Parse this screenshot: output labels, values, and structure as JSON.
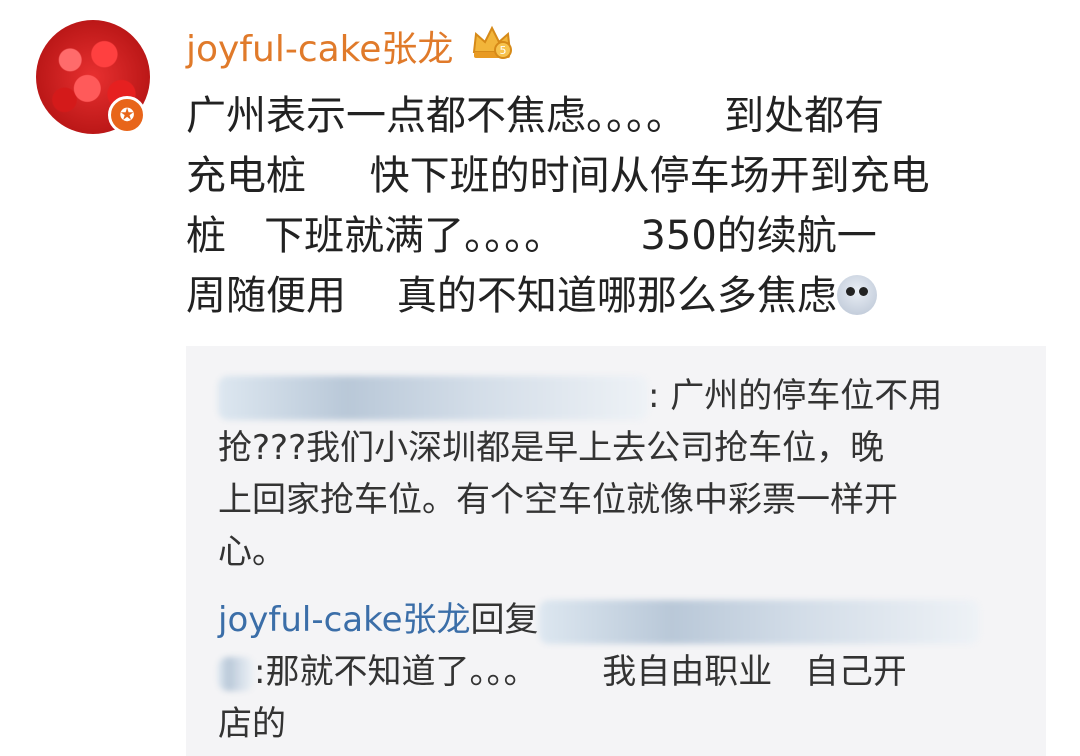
{
  "user": {
    "name": "joyful-cake张龙",
    "avatar_icon": "raspberry-avatar",
    "badge_icon": "star-badge-icon",
    "vip_icon": "crown-icon"
  },
  "comment": {
    "lines": [
      "广州表示一点都不焦虑。。。。   到处都有",
      "充电桩     快下班的时间从停车场开到充电",
      "桩   下班就满了。。。。      350的续航一",
      "周随便用    真的不知道哪那么多焦虑"
    ]
  },
  "reply": {
    "quoted_text_first": ": 广州的停车位不用",
    "quoted_lines": [
      "抢???我们小深圳都是早上去公司抢车位，晚",
      "上回家抢车位。有个空车位就像中彩票一样开",
      "心。"
    ],
    "replier_name": "joyful-cake张龙",
    "reply_word": "回复",
    "reply_text_first": ":那就不知道了。。。      我自由职业   自己开",
    "reply_text_second": "店的"
  }
}
